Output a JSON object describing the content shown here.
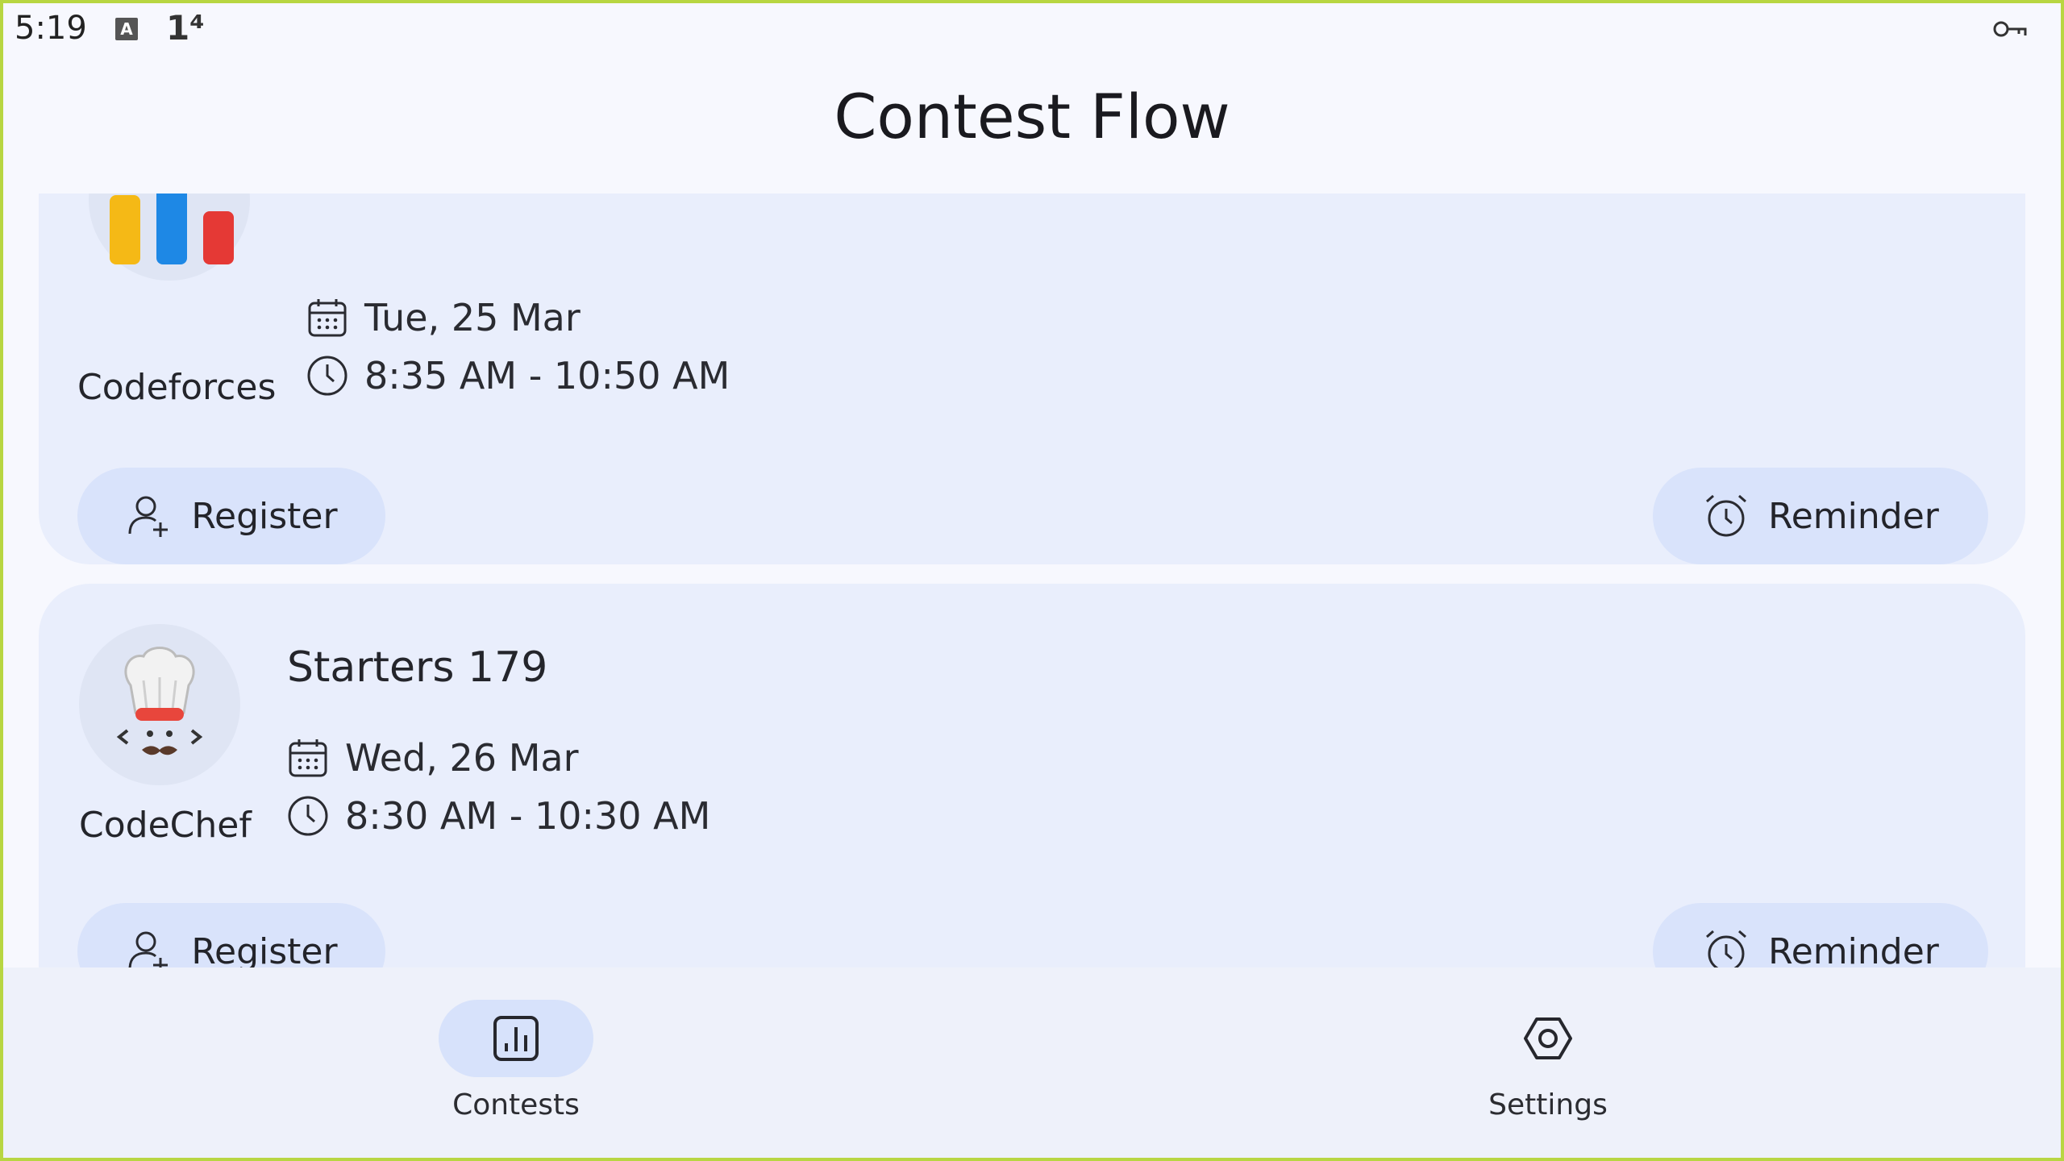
{
  "status_bar": {
    "time": "5:19",
    "a_icon_label": "A",
    "signal_icon_label": "1⁴",
    "key_icon": "key-icon"
  },
  "app": {
    "title": "Contest Flow"
  },
  "contests": [
    {
      "platform": "Codeforces",
      "title": "",
      "date": "Tue, 25 Mar",
      "time": "8:35 AM  - 10:50 AM",
      "register_label": "Register",
      "reminder_label": "Reminder"
    },
    {
      "platform": "CodeChef",
      "title": "Starters 179",
      "date": "Wed, 26 Mar",
      "time": "8:30 AM  - 10:30 AM",
      "register_label": "Register",
      "reminder_label": "Reminder"
    }
  ],
  "nav": {
    "contests_label": "Contests",
    "settings_label": "Settings"
  },
  "colors": {
    "background": "#f7f8fe",
    "card": "#e9eefc",
    "button": "#d9e3fb",
    "nav_active": "#d7e2fb",
    "frame": "#b8d642"
  }
}
